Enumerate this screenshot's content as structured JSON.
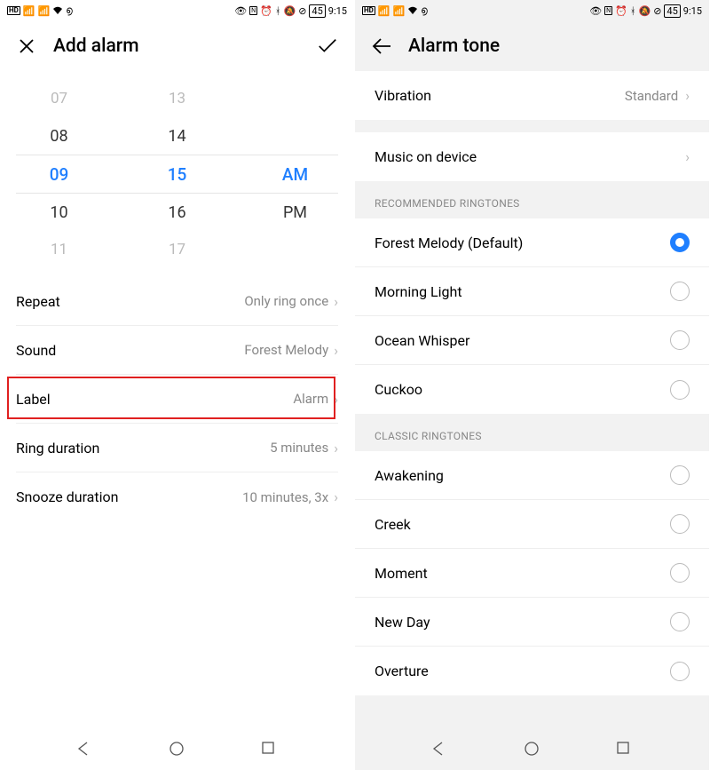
{
  "status": {
    "time": "9:15",
    "battery": "45",
    "hd": "HD"
  },
  "left": {
    "title": "Add alarm",
    "picker": {
      "hours": [
        "07",
        "08",
        "09",
        "10",
        "11"
      ],
      "minutes": [
        "13",
        "14",
        "15",
        "16",
        "17"
      ],
      "ampm": [
        "",
        "",
        "AM",
        "PM",
        ""
      ]
    },
    "settings": [
      {
        "label": "Repeat",
        "value": "Only ring once"
      },
      {
        "label": "Sound",
        "value": "Forest Melody"
      },
      {
        "label": "Label",
        "value": "Alarm"
      },
      {
        "label": "Ring duration",
        "value": "5 minutes"
      },
      {
        "label": "Snooze duration",
        "value": "10 minutes, 3x"
      }
    ]
  },
  "right": {
    "title": "Alarm tone",
    "vibration_label": "Vibration",
    "vibration_value": "Standard",
    "music_label": "Music on device",
    "recommended_header": "RECOMMENDED RINGTONES",
    "recommended": [
      {
        "label": "Forest Melody (Default)",
        "selected": true
      },
      {
        "label": "Morning Light",
        "selected": false
      },
      {
        "label": "Ocean Whisper",
        "selected": false
      },
      {
        "label": "Cuckoo",
        "selected": false
      }
    ],
    "classic_header": "CLASSIC RINGTONES",
    "classic": [
      {
        "label": "Awakening"
      },
      {
        "label": "Creek"
      },
      {
        "label": "Moment"
      },
      {
        "label": "New Day"
      },
      {
        "label": "Overture"
      }
    ]
  }
}
